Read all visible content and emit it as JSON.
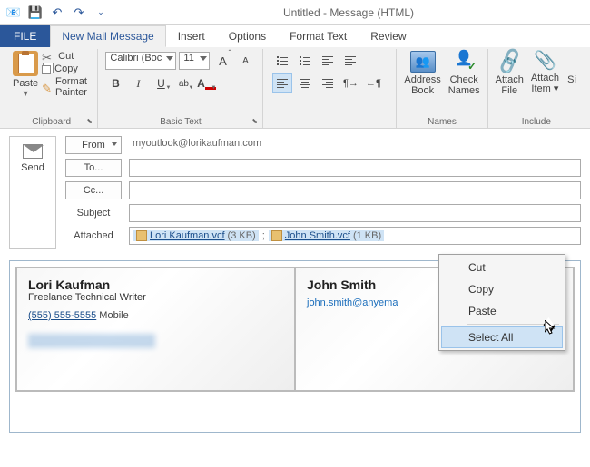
{
  "window": {
    "title": "Untitled - Message (HTML)"
  },
  "qat": {
    "save": "💾",
    "undo": "↶",
    "redo": "↷",
    "more": "▾",
    "ctrl": "⌄"
  },
  "tabs": {
    "file": "FILE",
    "newmail": "New Mail Message",
    "insert": "Insert",
    "options": "Options",
    "format": "Format Text",
    "review": "Review"
  },
  "clipboard": {
    "paste": "Paste",
    "cut": "Cut",
    "copy": "Copy",
    "formatpainter": "Format Painter",
    "label": "Clipboard"
  },
  "font": {
    "name": "Calibri (Boc",
    "size": "11",
    "label": "Basic Text"
  },
  "names": {
    "book": "Address\nBook",
    "check": "Check\nNames",
    "label": "Names"
  },
  "include": {
    "attachfile": "Attach\nFile",
    "attachitem": "Attach\nItem ▾",
    "sig": "Si",
    "label": "Include"
  },
  "compose": {
    "send": "Send",
    "from": "From ",
    "fromaddr": "myoutlook@lorikaufman.com",
    "to": "To...",
    "cc": "Cc...",
    "subject": "Subject",
    "attached": "Attached"
  },
  "attachments": [
    {
      "name": "Lori Kaufman.vcf",
      "size": "(3 KB)"
    },
    {
      "name": "John Smith.vcf",
      "size": "(1 KB)"
    }
  ],
  "sep": ";",
  "cards": [
    {
      "name": "Lori Kaufman",
      "role": "Freelance Technical Writer",
      "phone": "(555) 555-5555",
      "phone_type": "Mobile"
    },
    {
      "name": "John Smith",
      "email": "john.smith@anyema"
    }
  ],
  "ctx": {
    "cut": "Cut",
    "copy": "Copy",
    "paste": "Paste",
    "selectall": "Select All"
  }
}
